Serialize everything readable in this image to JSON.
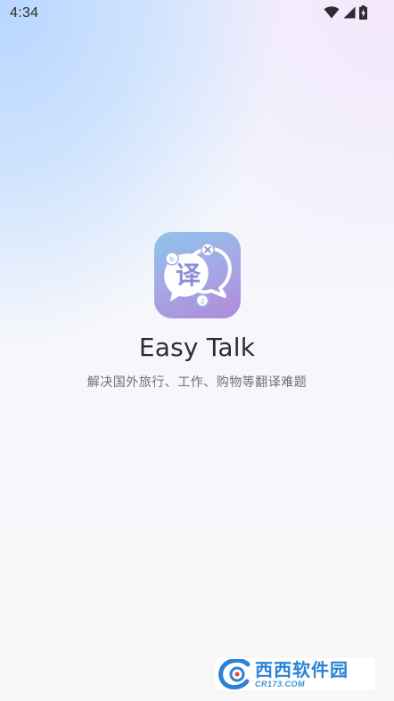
{
  "status_bar": {
    "time": "4:34",
    "icons": [
      "wifi-icon",
      "cellular-signal-icon",
      "battery-charging-icon"
    ]
  },
  "splash": {
    "logo_icon": "translate-chat-bubbles-icon",
    "logo_glyph": "译",
    "app_name": "Easy Talk",
    "tagline": "解决国外旅行、工作、购物等翻译难题"
  },
  "watermark": {
    "title": "西西软件园",
    "subtitle": "CR173.COM"
  },
  "colors": {
    "logo_gradient_top": "#8ec4ec",
    "logo_gradient_bottom": "#b08ad9",
    "text_primary": "#2b2d33",
    "text_secondary": "#6d6f73",
    "watermark_blue": "#2a83d6"
  }
}
